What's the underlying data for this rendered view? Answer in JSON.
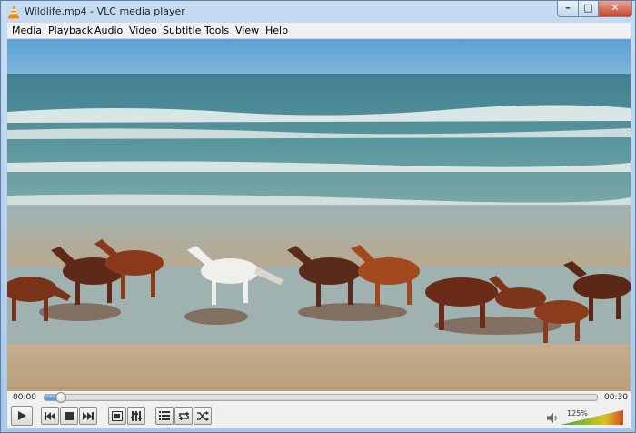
{
  "window": {
    "title": "Wildlife.mp4 - VLC media player",
    "controls": {
      "minimize": "–",
      "maximize": "□",
      "close": "✕"
    }
  },
  "menu": {
    "items": [
      "Media",
      "Playback",
      "Audio",
      "Video",
      "Subtitle",
      "Tools",
      "View",
      "Help"
    ]
  },
  "player": {
    "elapsed": "00:00",
    "duration": "00:30",
    "progress_fraction": 0.02,
    "volume": "125%",
    "volume_fraction": 1.0
  },
  "buttons": {
    "play": "play-icon",
    "previous": "previous-icon",
    "stop": "stop-icon",
    "next": "next-icon",
    "fullscreen": "fullscreen-icon",
    "extended_settings": "equalizer-icon",
    "playlist": "playlist-icon",
    "loop": "loop-icon",
    "random": "shuffle-icon",
    "mute": "speaker-icon"
  },
  "colors": {
    "accent": "#4f8fce",
    "volume_low": "#3fae3f",
    "volume_high": "#d94a1e",
    "vlc_orange": "#f28b00"
  }
}
